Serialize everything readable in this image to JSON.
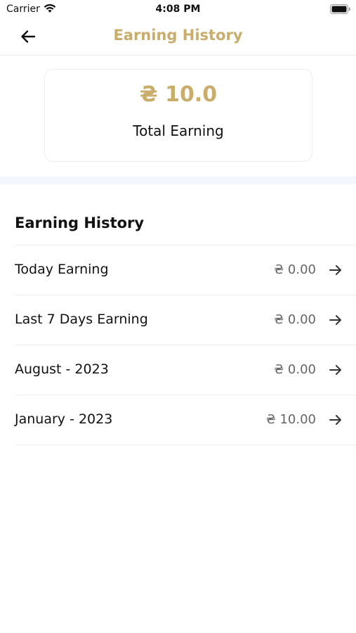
{
  "status_bar": {
    "carrier": "Carrier",
    "time": "4:08 PM"
  },
  "nav": {
    "title": "Earning History",
    "back_icon": "arrow-left-icon"
  },
  "summary": {
    "amount": "₴ 10.0",
    "label": "Total Earning"
  },
  "section": {
    "heading": "Earning History"
  },
  "rows": [
    {
      "label": "Today Earning",
      "amount": "₴ 0.00"
    },
    {
      "label": "Last 7 Days Earning",
      "amount": "₴ 0.00"
    },
    {
      "label": "August - 2023",
      "amount": "₴ 0.00"
    },
    {
      "label": "January - 2023",
      "amount": "₴ 10.00"
    }
  ],
  "colors": {
    "accent": "#c9ad6b",
    "band": "#f3f6fc"
  }
}
